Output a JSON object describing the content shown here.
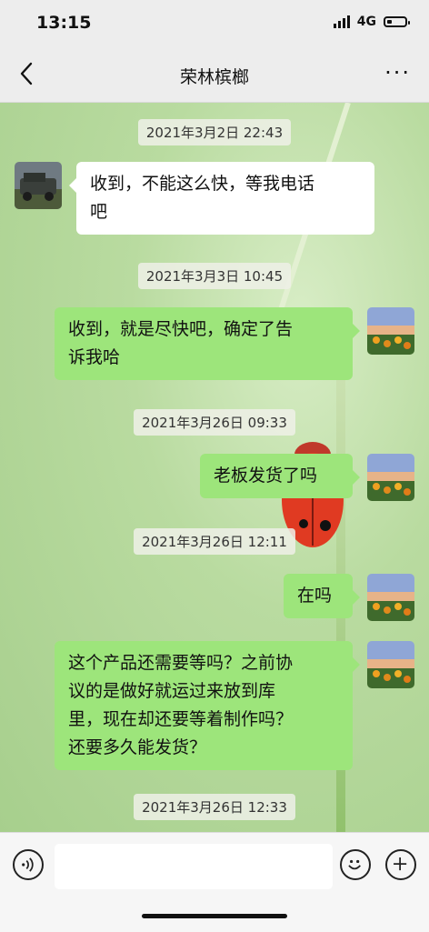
{
  "status": {
    "time": "13:15",
    "network": "4G",
    "battery_level": 0.25
  },
  "nav": {
    "title": "荣林槟榔",
    "back_icon": "chevron-left-icon",
    "more_label": "···"
  },
  "messages": [
    {
      "timestamp": "2021年3月2日 22:43"
    },
    {
      "side": "left",
      "text1": "收到，不能这么快，等我电话",
      "text2": "吧"
    },
    {
      "timestamp": "2021年3月3日 10:45"
    },
    {
      "side": "right",
      "text1": "收到，就是尽快吧，确定了告",
      "text2": "诉我哈"
    },
    {
      "timestamp": "2021年3月26日 09:33"
    },
    {
      "side": "right",
      "text1": "老板发货了吗"
    },
    {
      "timestamp": "2021年3月26日 12:11"
    },
    {
      "side": "right",
      "text1": "在吗"
    },
    {
      "side": "right",
      "text1": "这个产品还需要等吗？之前协",
      "text2": "议的是做好就运过来放到库",
      "text3": "里，现在却还要等着制作吗？",
      "text4": "还要多久能发货？"
    },
    {
      "timestamp": "2021年3月26日 12:33"
    }
  ],
  "input": {
    "placeholder": ""
  },
  "colors": {
    "bubble_self": "#9de57b",
    "bubble_other": "#ffffff",
    "bar_bg": "#ededed"
  }
}
